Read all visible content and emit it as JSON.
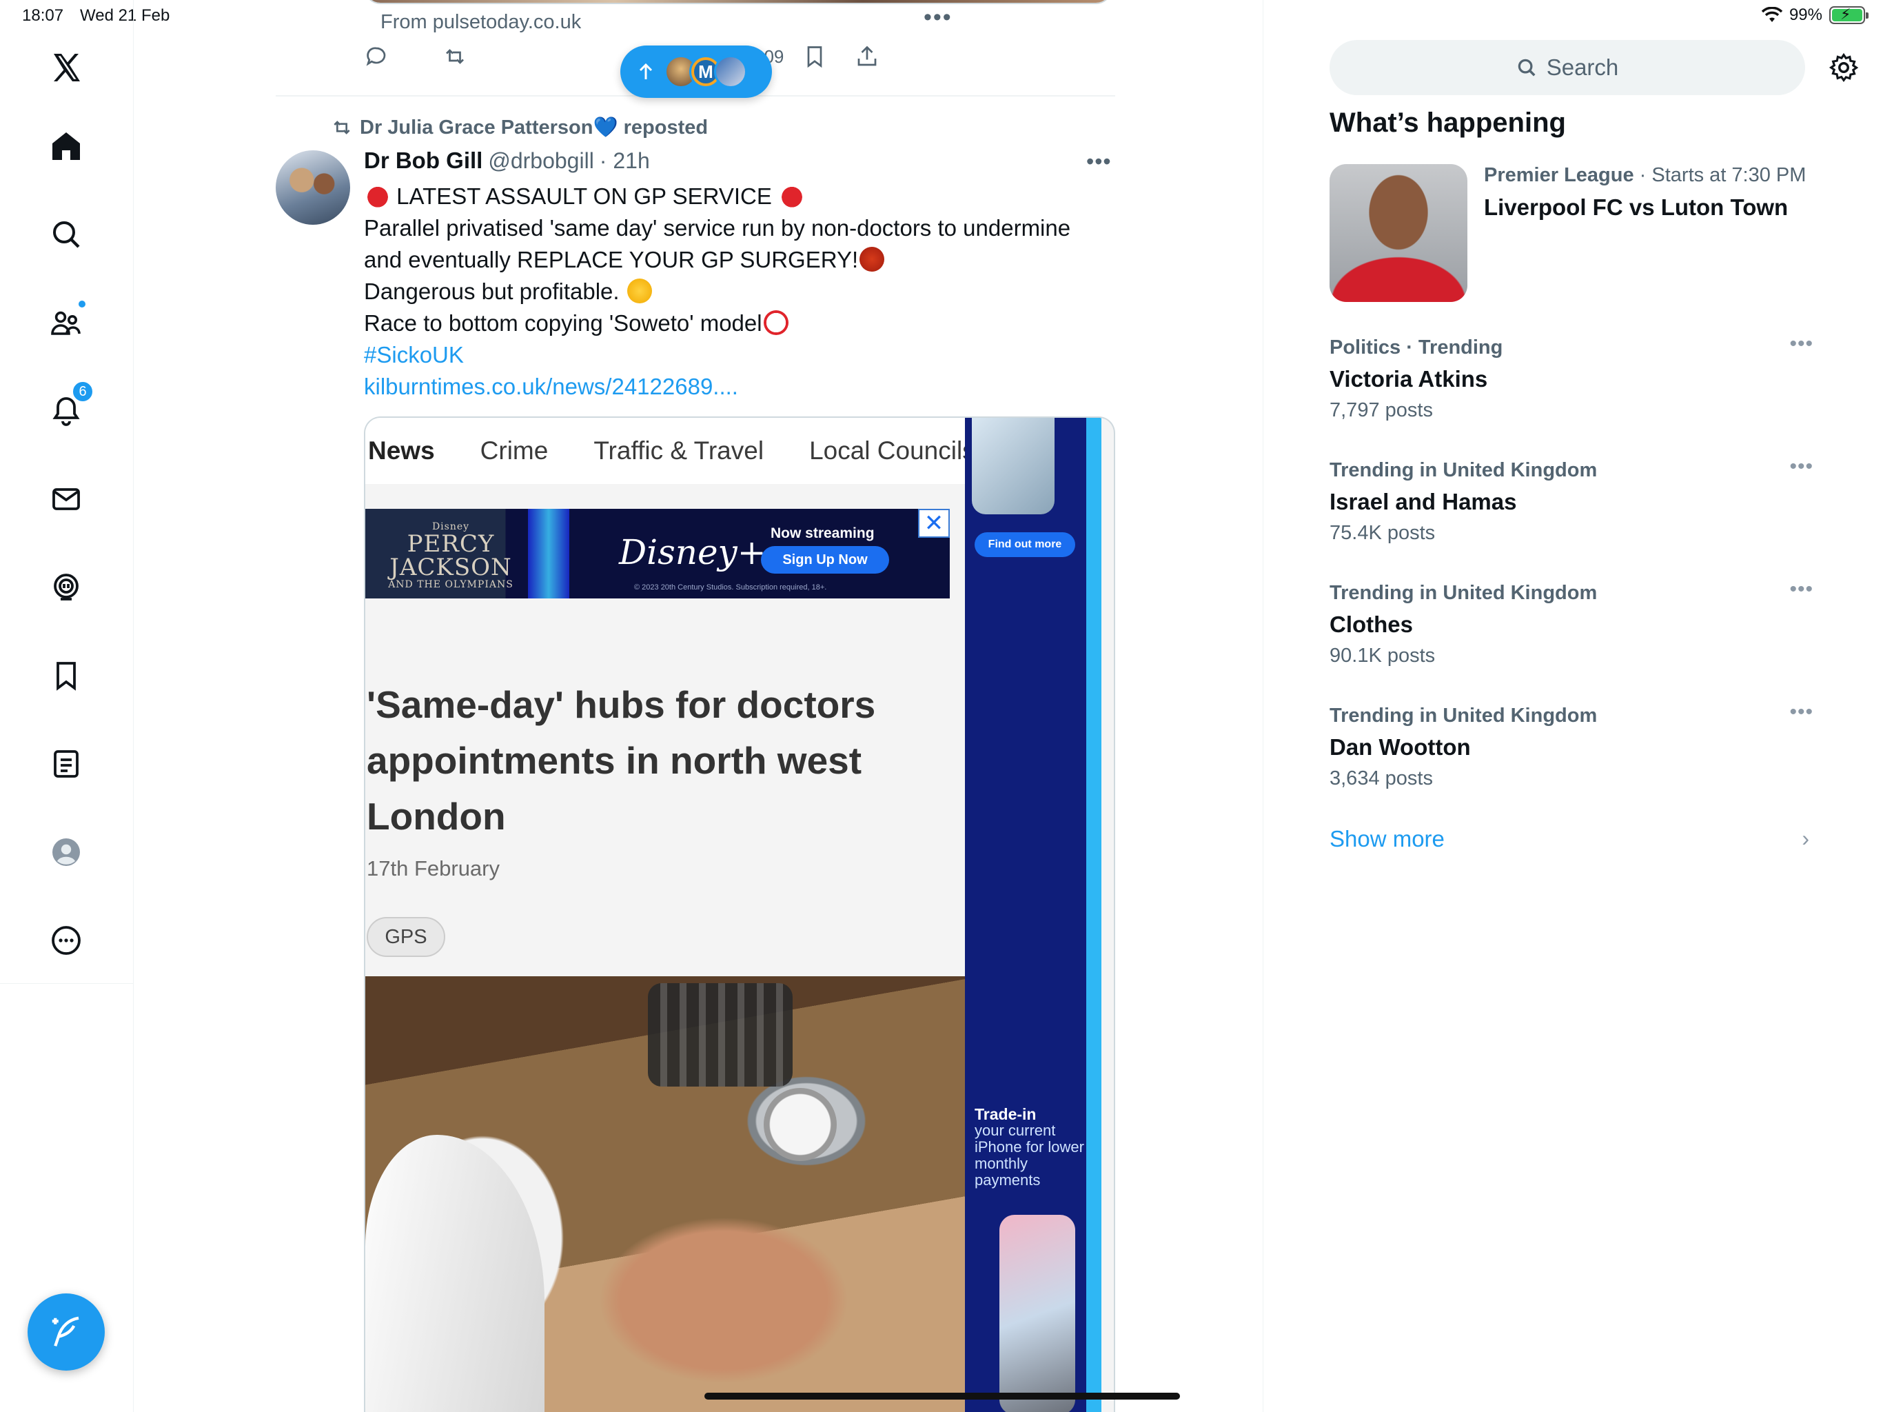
{
  "status_bar": {
    "time": "18:07",
    "date": "Wed 21 Feb",
    "battery": "99%"
  },
  "nav": {
    "items": [
      {
        "name": "x-logo-icon"
      },
      {
        "name": "home-icon"
      },
      {
        "name": "explore-search-icon"
      },
      {
        "name": "communities-icon",
        "dot": true
      },
      {
        "name": "notifications-icon",
        "badge": "6"
      },
      {
        "name": "messages-icon"
      },
      {
        "name": "grok-icon"
      },
      {
        "name": "bookmarks-icon"
      },
      {
        "name": "lists-icon"
      },
      {
        "name": "profile-icon"
      },
      {
        "name": "more-icon"
      }
    ],
    "compose_icon": "compose-feather-icon",
    "accent": "#1d9bf0"
  },
  "previous_post": {
    "source": "From pulsetoday.co.uk",
    "more": "•••",
    "views": "209"
  },
  "new_posts_pill": {
    "avatar_letter": "M"
  },
  "post": {
    "reposted_by": "Dr Julia Grace Patterson💙 reposted",
    "author_name": "Dr Bob Gill",
    "handle": "@drbobgill",
    "time": "· 21h",
    "more": "•••",
    "lines": [
      "LATEST ASSAULT ON GP SERVICE",
      "Parallel privatised 'same day' service run by non-doctors to undermine",
      "and eventually REPLACE YOUR GP SURGERY!",
      "Dangerous but profitable.",
      "Race to bottom copying 'Soweto' model"
    ],
    "hashtag": "#SickoUK",
    "link": "kilburntimes.co.uk/news/24122689...."
  },
  "embed": {
    "site_nav": [
      "News",
      "Crime",
      "Traffic & Travel",
      "Local Councils"
    ],
    "ad": {
      "percy_title": "PERCY JACKSON",
      "percy_sub": "AND THE OLYMPIANS",
      "percy_brand": "Disney",
      "brand": "Disney+",
      "now_streaming": "Now streaming",
      "cta": "Sign Up Now",
      "fine_print": "© 2023 20th Century Studios. Subscription required, 18+.",
      "close": "✕"
    },
    "headline": "'Same-day' hubs for doctors appointments in north west London",
    "date": "17th February",
    "tag": "GPS",
    "side_ad": {
      "cta": "Find out more",
      "tradein_title": "Trade-in",
      "tradein_body": "your current iPhone for lower monthly payments"
    }
  },
  "right": {
    "search_placeholder": "Search",
    "section_title": "What’s happening",
    "event": {
      "category": "Premier League",
      "when": "· Starts at 7:30 PM",
      "title": "Liverpool FC vs Luton Town"
    },
    "trends": [
      {
        "context": "Politics · Trending",
        "name": "Victoria Atkins",
        "count": "7,797 posts"
      },
      {
        "context": "Trending in United Kingdom",
        "name": "Israel and Hamas",
        "count": "75.4K posts"
      },
      {
        "context": "Trending in United Kingdom",
        "name": "Clothes",
        "count": "90.1K posts"
      },
      {
        "context": "Trending in United Kingdom",
        "name": "Dan Wootton",
        "count": "3,634 posts"
      }
    ],
    "trend_more": "•••",
    "show_more": "Show more",
    "chevron": "›"
  }
}
